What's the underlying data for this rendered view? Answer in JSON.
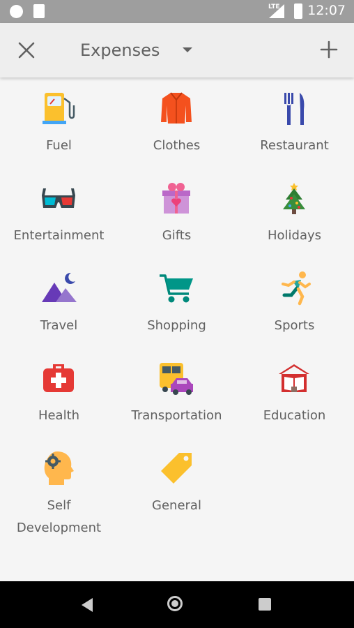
{
  "status_bar": {
    "time": "12:07",
    "network": "LTE"
  },
  "toolbar": {
    "title": "Expenses"
  },
  "categories": [
    {
      "label": "Fuel",
      "icon": "fuel-pump-icon"
    },
    {
      "label": "Clothes",
      "icon": "jacket-icon"
    },
    {
      "label": "Restaurant",
      "icon": "fork-knife-icon"
    },
    {
      "label": "Entertainment",
      "icon": "3d-glasses-icon"
    },
    {
      "label": "Gifts",
      "icon": "gift-box-icon"
    },
    {
      "label": "Holidays",
      "icon": "christmas-tree-icon"
    },
    {
      "label": "Travel",
      "icon": "mountains-moon-icon"
    },
    {
      "label": "Shopping",
      "icon": "shopping-cart-icon"
    },
    {
      "label": "Sports",
      "icon": "runner-icon"
    },
    {
      "label": "Health",
      "icon": "first-aid-icon"
    },
    {
      "label": "Transportation",
      "icon": "bus-car-icon"
    },
    {
      "label": "Education",
      "icon": "school-book-icon"
    },
    {
      "label": "Self\nDevelopment",
      "icon": "head-gear-icon"
    },
    {
      "label": "General",
      "icon": "price-tag-icon"
    }
  ],
  "colors": {
    "status_bar": "#9e9e9e",
    "toolbar": "#eeeeee",
    "background": "#f5f5f5",
    "text": "#616161"
  }
}
